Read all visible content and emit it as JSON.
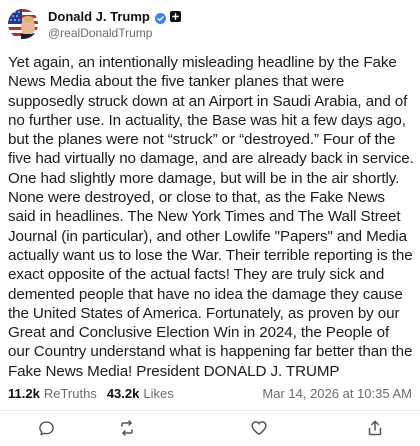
{
  "author": {
    "display_name": "Donald J. Trump",
    "handle": "@realDonaldTrump",
    "verified_badge_icon": "verified-badge-icon",
    "plus_icon": "plus-icon"
  },
  "post": {
    "text": "Yet again, an intentionally misleading headline by the Fake News Media about the five tanker planes that were supposedly struck down at an Airport in Saudi Arabia, and of no further use. In actuality, the Base was hit a few days ago, but the planes were not “struck” or “destroyed.” Four of the five had virtually no damage, and are already back in service. One had slightly more damage, but will be in the air shortly. None were destroyed, or close to that, as the Fake News said in headlines. The New York Times and The Wall Street Journal (in particular), and other Lowlife \"Papers\" and Media actually want us to lose the War. Their terrible reporting is the exact opposite of the actual facts! They are truly sick and demented people that have no idea the damage they cause the United States of America. Fortunately, as proven by our Great and Conclusive Election Win in 2024, the People of our Country understand what is happening far better than the Fake News Media! President DONALD J. TRUMP"
  },
  "stats": {
    "retruths_count": "11.2k",
    "retruths_label": "ReTruths",
    "likes_count": "43.2k",
    "likes_label": "Likes",
    "timestamp": "Mar 14, 2026 at 10:35 AM"
  },
  "actions": [
    {
      "name": "reply",
      "icon": "comment-icon"
    },
    {
      "name": "retruth",
      "icon": "retruth-icon"
    },
    {
      "name": "like",
      "icon": "heart-icon"
    },
    {
      "name": "share",
      "icon": "share-icon"
    }
  ],
  "colors": {
    "badge": "#3b82f6",
    "text": "#1c1c1c",
    "muted": "#6b6b6b",
    "icon": "#555555"
  }
}
